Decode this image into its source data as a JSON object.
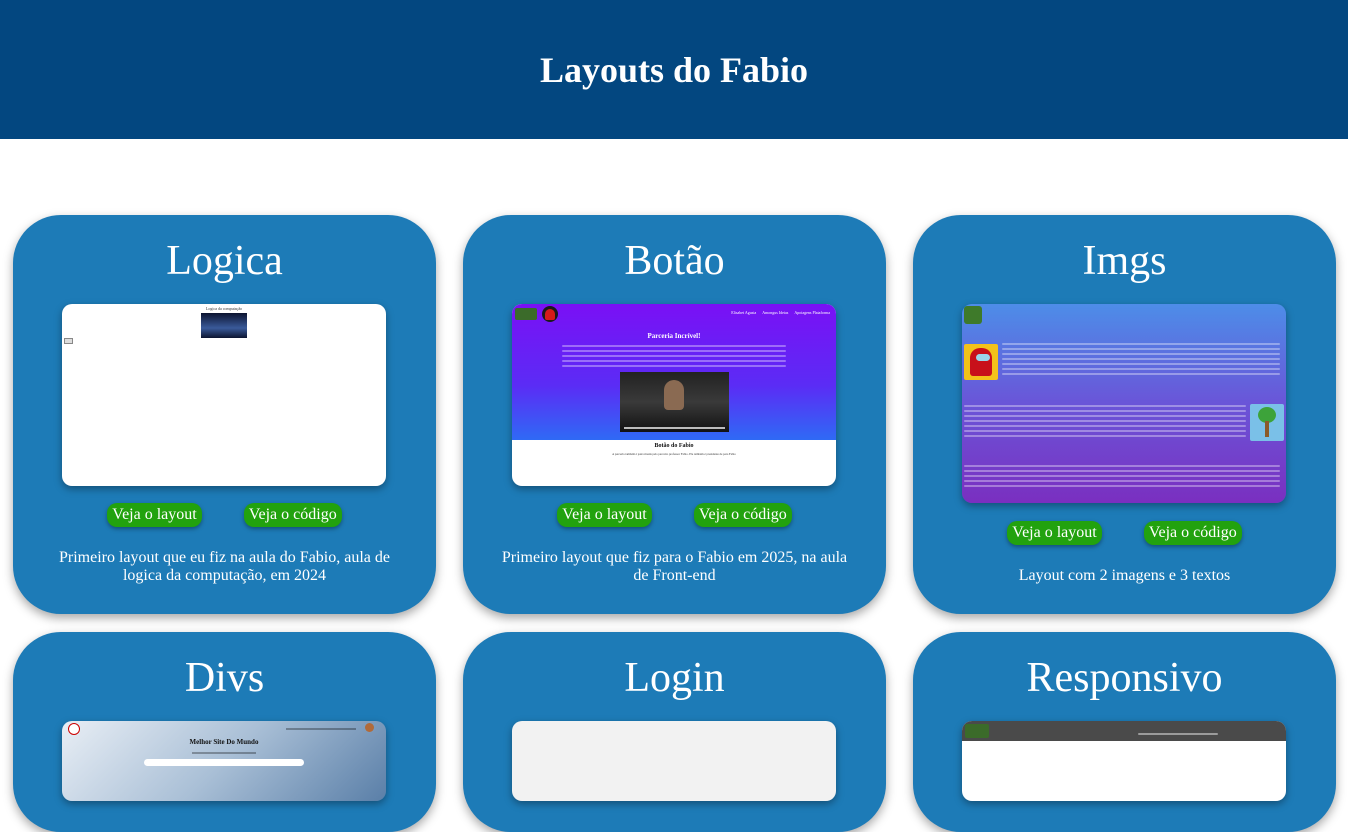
{
  "header": {
    "title": "Layouts do Fabio"
  },
  "cards": [
    {
      "title": "Logica",
      "preview": {
        "heading": "Logica da computação"
      },
      "layout_button": "Veja o layout",
      "code_button": "Veja o código",
      "description": "Primeiro layout que eu fiz na aula do Fabio, aula de logica da computação, em 2024"
    },
    {
      "title": "Botão",
      "preview": {
        "nav": [
          "Elisabet Agusta",
          "Amongus Ideias",
          "Apoiagens Plataforma"
        ],
        "heading": "Parceria Incrível!",
        "footer_title": "Botão do Fabio",
        "footer_text": "A parceria também é patrocinada pelo parceiro professor Fabio. Ele também é presidente de para Fabio"
      },
      "layout_button": "Veja o layout",
      "code_button": "Veja o código",
      "description": "Primeiro layout que fiz para o Fabio em 2025, na aula de Front-end"
    },
    {
      "title": "Imgs",
      "preview": {},
      "layout_button": "Veja o layout",
      "code_button": "Veja o código",
      "description": "Layout com 2 imagens e 3 textos"
    },
    {
      "title": "Divs",
      "preview": {
        "heading": "Melhor Site Do Mundo"
      }
    },
    {
      "title": "Login",
      "preview": {}
    },
    {
      "title": "Responsivo",
      "preview": {}
    }
  ]
}
